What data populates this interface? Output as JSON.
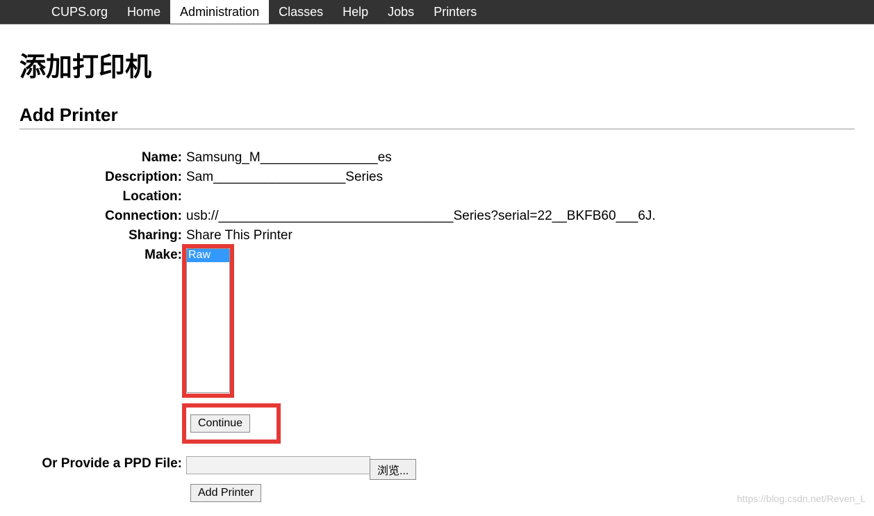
{
  "nav": {
    "items": [
      {
        "label": "CUPS.org"
      },
      {
        "label": "Home"
      },
      {
        "label": "Administration"
      },
      {
        "label": "Classes"
      },
      {
        "label": "Help"
      },
      {
        "label": "Jobs"
      },
      {
        "label": "Printers"
      }
    ],
    "active_index": 2
  },
  "page": {
    "title_cn": "添加打印机",
    "title_en": "Add Printer"
  },
  "form": {
    "labels": {
      "name": "Name:",
      "description": "Description:",
      "location": "Location:",
      "connection": "Connection:",
      "sharing": "Sharing:",
      "make": "Make:",
      "ppd": "Or Provide a PPD File:"
    },
    "values": {
      "name": "Samsung_M________________es",
      "description": "Sam__________________Series",
      "location": "",
      "connection": "usb://________________________________Series?serial=22__BKFB60___6J.",
      "sharing": "Share This Printer"
    },
    "make_options": [
      "Raw"
    ],
    "make_selected": "Raw",
    "buttons": {
      "continue": "Continue",
      "browse": "浏览...",
      "add_printer": "Add Printer"
    }
  },
  "watermark": "https://blog.csdn.net/Reven_L"
}
